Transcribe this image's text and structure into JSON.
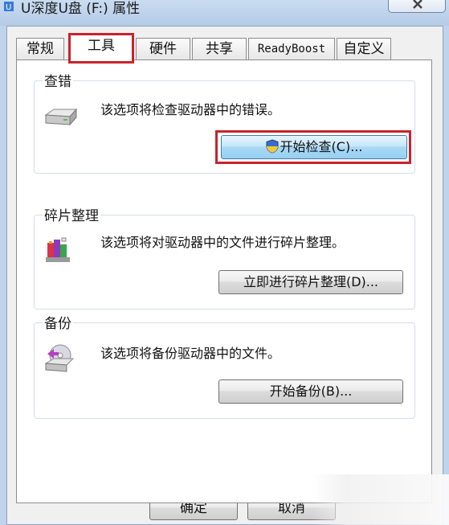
{
  "window": {
    "title": "U深度U盘 (F:) 属性"
  },
  "tabs": [
    {
      "label": "常规"
    },
    {
      "label": "工具"
    },
    {
      "label": "硬件"
    },
    {
      "label": "共享"
    },
    {
      "label": "ReadyBoost"
    },
    {
      "label": "自定义"
    }
  ],
  "active_tab": "工具",
  "sections": {
    "error_check": {
      "title": "查错",
      "description": "该选项将检查驱动器中的错误。",
      "button_label": "开始检查(C)...",
      "icon": "drive-icon"
    },
    "defrag": {
      "title": "碎片整理",
      "description": "该选项将对驱动器中的文件进行碎片整理。",
      "button_label": "立即进行碎片整理(D)...",
      "icon": "defrag-icon"
    },
    "backup": {
      "title": "备份",
      "description": "该选项将备份驱动器中的文件。",
      "button_label": "开始备份(B)...",
      "icon": "backup-icon"
    }
  },
  "footer": {
    "ok_label": "确定",
    "cancel_label": "取消"
  },
  "colors": {
    "highlight_red": "#c8232c",
    "focus_blue": "#97cff1"
  }
}
